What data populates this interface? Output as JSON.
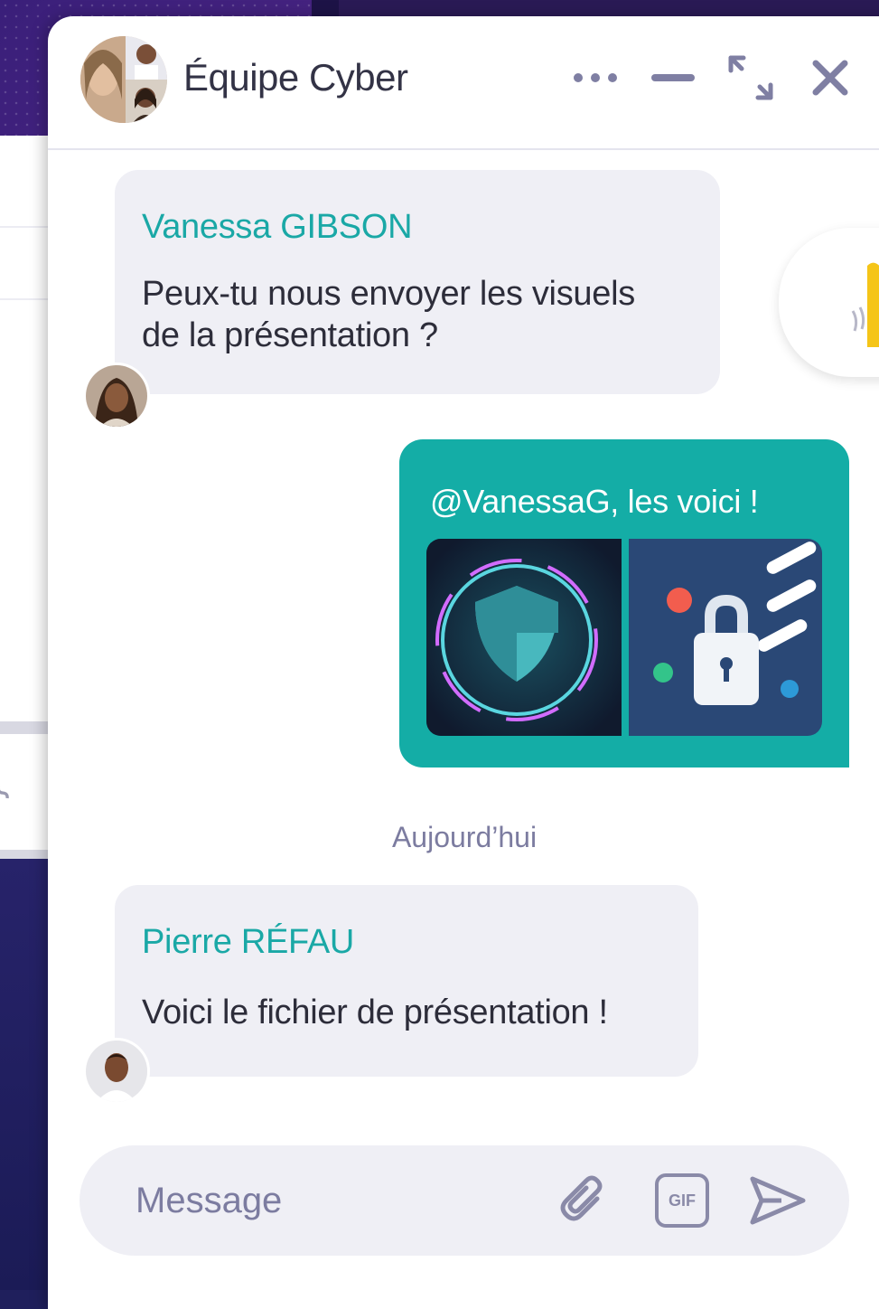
{
  "chat": {
    "title": "Équipe Cyber",
    "header_icons": [
      "more-icon",
      "minimize-icon",
      "expand-icon",
      "close-icon"
    ],
    "accent_color": "#14ada6",
    "sender_color": "#1aa8a6"
  },
  "messages": [
    {
      "sender": "Vanessa GIBSON",
      "lines": [
        "Peux-tu nous envoyer les visuels",
        "de la présentation ?"
      ],
      "direction": "incoming"
    },
    {
      "text": "@VanessaG, les voici !",
      "attachments": [
        "cyber-shield-image",
        "padlock-image"
      ],
      "direction": "outgoing"
    },
    {
      "date_separator": "Aujourd’hui"
    },
    {
      "sender": "Pierre RÉFAU",
      "text": "Voici le fichier de présentation !",
      "direction": "incoming"
    }
  ],
  "composer": {
    "placeholder": "Message",
    "gif_label": "GIF",
    "icons": [
      "attach-icon",
      "gif-icon",
      "send-icon"
    ]
  }
}
